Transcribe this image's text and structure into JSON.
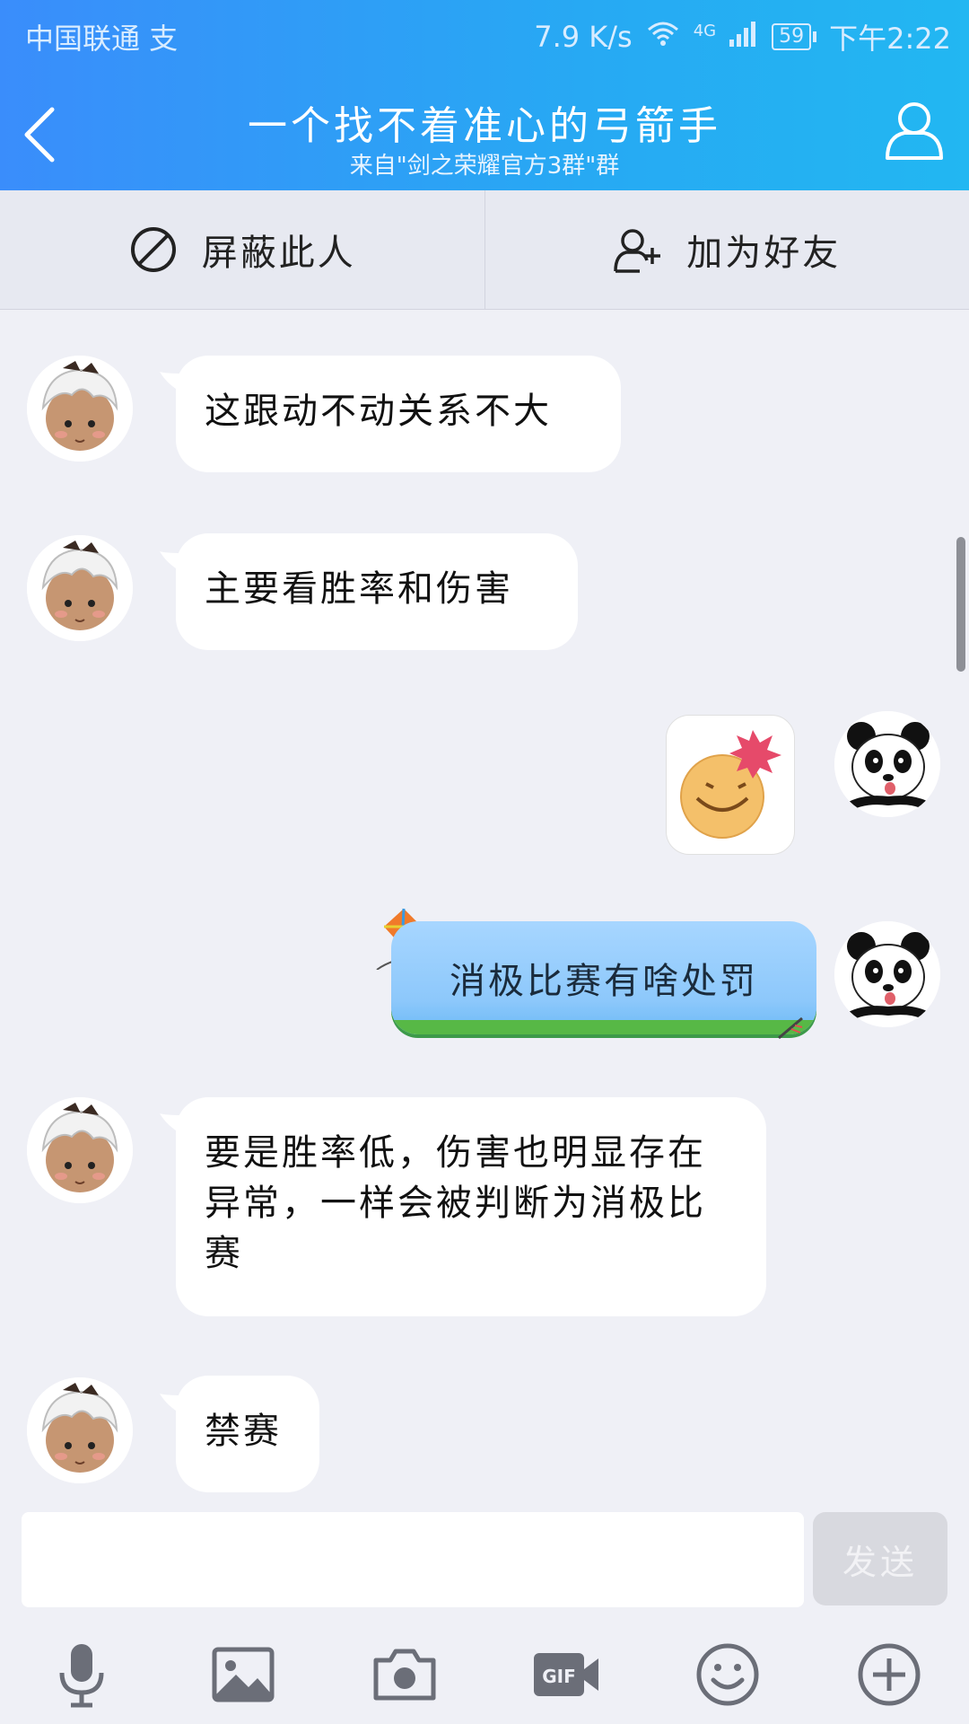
{
  "status_bar": {
    "carrier": "中国联通 支",
    "speed": "7.9 K/s",
    "network": "4G",
    "battery": "59",
    "time": "下午2:22"
  },
  "header": {
    "title": "一个找不着准心的弓箭手",
    "subtitle": "来自\"剑之荣耀官方3群\"群"
  },
  "actions": {
    "block_label": "屏蔽此人",
    "add_friend_label": "加为好友"
  },
  "messages": [
    {
      "side": "left",
      "text": "这跟动不动关系不大"
    },
    {
      "side": "left",
      "text": "主要看胜率和伤害"
    },
    {
      "side": "right",
      "type": "sticker",
      "icon": "angry-smiley-sticker"
    },
    {
      "side": "right",
      "text": "消极比赛有啥处罚"
    },
    {
      "side": "left",
      "text": "要是胜率低，伤害也明显存在异常，一样会被判断为消极比赛"
    },
    {
      "side": "left",
      "text": "禁赛"
    }
  ],
  "input": {
    "placeholder": "",
    "send_label": "发送"
  },
  "toolbar": [
    "microphone-icon",
    "image-icon",
    "camera-icon",
    "gif-icon",
    "emoji-icon",
    "plus-icon"
  ],
  "colors": {
    "header_start": "#3a8dfb",
    "header_end": "#22b7f2",
    "background": "#eff0f6",
    "my_bubble": "#8dc8fb"
  }
}
